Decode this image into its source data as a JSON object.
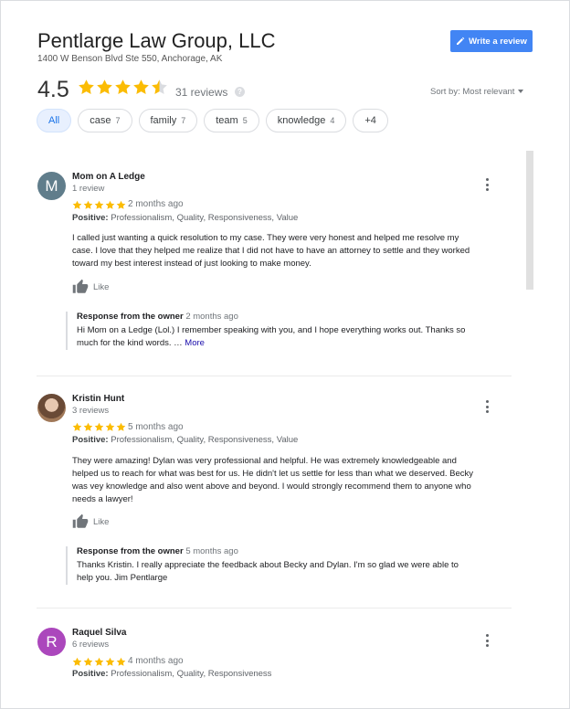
{
  "business": {
    "title": "Pentlarge Law Group, LLC",
    "address": "1400 W Benson Blvd Ste 550, Anchorage, AK"
  },
  "write_review": {
    "label": "Write a review",
    "icon": "pencil-icon",
    "color": "#4285f4"
  },
  "summary": {
    "rating": "4.5",
    "stars_value": 4.5,
    "reviews_label": "31 reviews",
    "help_icon": "?",
    "star_color": "#fbbc04"
  },
  "sort": {
    "label": "Sort by:",
    "value": "Most relevant"
  },
  "chips": [
    {
      "label": "All",
      "count": ""
    },
    {
      "label": "case",
      "count": "7"
    },
    {
      "label": "family",
      "count": "7"
    },
    {
      "label": "team",
      "count": "5"
    },
    {
      "label": "knowledge",
      "count": "4"
    },
    {
      "label": "+4",
      "count": ""
    }
  ],
  "reviews": [
    {
      "name": "Mom on A Ledge",
      "count": "1 review",
      "avatar_letter": "M",
      "avatar_color": "#607d8b",
      "stars": 5,
      "date": "2 months ago",
      "positive_label": "Positive:",
      "positive_values": "Professionalism, Quality, Responsiveness, Value",
      "text_lines": [
        "I called just wanting a quick resolution to my case. They were very honest and helped me resolve my",
        "case. I love that they helped me realize that I did not have to have an attorney to settle and they worked",
        "toward my best interest instead of just looking to make money."
      ],
      "like": "Like",
      "owner_title": "Response from the owner",
      "owner_date": "2 months ago",
      "owner_lines": [
        "Hi Mom on a Ledge (Lol.) I remember speaking with you, and I hope everything works out. Thanks so",
        "much for the kind words. …"
      ],
      "owner_more": "More"
    },
    {
      "name": "Kristin Hunt",
      "count": "3 reviews",
      "avatar_letter": "",
      "avatar_color": "#8d6e63",
      "stars": 5,
      "date": "5 months ago",
      "positive_label": "Positive:",
      "positive_values": "Professionalism, Quality, Responsiveness, Value",
      "text_lines": [
        "They were amazing! Dylan was very professional and helpful. He was extremely  knowledgeable and",
        "helped us to reach for what was best for us. He didn't let us settle for less than what we deserved. Becky",
        "was vey knowledge and also went above and beyond. I would strongly recommend them to anyone who",
        "needs a lawyer!"
      ],
      "like": "Like",
      "owner_title": "Response from the owner",
      "owner_date": "5 months ago",
      "owner_lines": [
        "Thanks Kristin. I really appreciate the feedback about Becky and Dylan. I'm so glad we were able to",
        "help you. Jim Pentlarge"
      ],
      "owner_more": ""
    },
    {
      "name": "Raquel Silva",
      "count": "6 reviews",
      "avatar_letter": "R",
      "avatar_color": "#ab47bc",
      "stars": 5,
      "date": "4 months ago",
      "positive_label": "Positive:",
      "positive_values": "Professionalism, Quality, Responsiveness"
    }
  ]
}
